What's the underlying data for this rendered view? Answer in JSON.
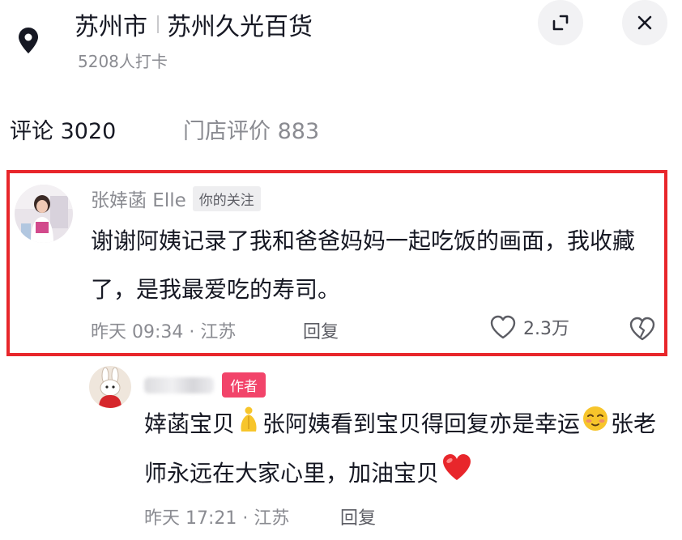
{
  "header": {
    "city": "苏州市",
    "place_name": "苏州久光百货",
    "checkins": "5208人打卡",
    "icons": {
      "location": "location-pin-icon",
      "expand": "expand-icon",
      "close": "close-icon"
    }
  },
  "tabs": [
    {
      "label": "评论 3020",
      "active": true
    },
    {
      "label": "门店评价 883",
      "active": false
    }
  ],
  "colors": {
    "highlight_border": "#e8262b",
    "author_badge": "#f2446a",
    "text_primary": "#161823",
    "text_secondary": "#8a8b91"
  },
  "comments": [
    {
      "username": "张婞菡 Elle",
      "badge": "你的关注",
      "text": "谢谢阿姨记录了我和爸爸妈妈一起吃饭的画面，我收藏了，是我最爱吃的寿司。",
      "meta": "昨天 09:34 · 江苏",
      "reply_label": "回复",
      "likes": "2.3万",
      "highlighted": true,
      "icons": {
        "like": "heart-outline-icon",
        "dislike": "broken-heart-icon"
      }
    }
  ],
  "replies": [
    {
      "username_blurred": true,
      "badge": "作者",
      "text_part1": "婞菡宝贝",
      "emoji1": "pray-hands-emoji-icon",
      "text_part2": "张阿姨看到宝贝得回复亦是幸运",
      "emoji2": "shy-face-emoji-icon",
      "text_part3": "张老师永远在大家心里，加油宝贝",
      "emoji3": "red-heart-emoji-icon",
      "meta": "昨天 17:21 · 江苏",
      "reply_label": "回复"
    }
  ]
}
